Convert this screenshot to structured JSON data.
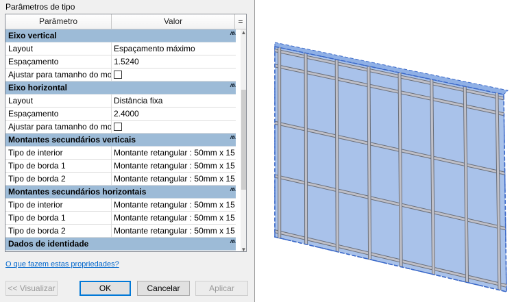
{
  "dialog": {
    "section_title": "Parâmetros de tipo",
    "columns": [
      "Parâmetro",
      "Valor",
      "="
    ],
    "groups": [
      {
        "title": "Eixo vertical",
        "rows": [
          {
            "param": "Layout",
            "value": "Espaçamento máximo"
          },
          {
            "param": "Espaçamento",
            "value": "1.5240"
          },
          {
            "param": "Ajustar para tamanho do mon",
            "value": "",
            "checkbox": true
          }
        ]
      },
      {
        "title": "Eixo horizontal",
        "rows": [
          {
            "param": "Layout",
            "value": "Distância fixa"
          },
          {
            "param": "Espaçamento",
            "value": "2.4000"
          },
          {
            "param": "Ajustar para tamanho do mon",
            "value": "",
            "checkbox": true
          }
        ]
      },
      {
        "title": "Montantes secundários verticais",
        "rows": [
          {
            "param": "Tipo de interior",
            "value": "Montante retangular : 50mm x 15"
          },
          {
            "param": "Tipo de borda 1",
            "value": "Montante retangular : 50mm x 15"
          },
          {
            "param": "Tipo de borda 2",
            "value": "Montante retangular : 50mm x 15"
          }
        ]
      },
      {
        "title": "Montantes secundários horizontais",
        "rows": [
          {
            "param": "Tipo de interior",
            "value": "Montante retangular : 50mm x 15"
          },
          {
            "param": "Tipo de borda 1",
            "value": "Montante retangular : 50mm x 15"
          },
          {
            "param": "Tipo de borda 2",
            "value": "Montante retangular : 50mm x 15"
          }
        ]
      },
      {
        "title": "Dados de identidade",
        "rows": []
      }
    ],
    "help_link": "O que fazem estas propriedades?",
    "buttons": {
      "preview": "<< Visualizar",
      "ok": "OK",
      "cancel": "Cancelar",
      "apply": "Aplicar"
    }
  },
  "colors": {
    "group_header": "#9dbbd7",
    "glass": "#a9c2ea",
    "mullion": "#c0c0c8",
    "selection_outline": "#3a68c8"
  },
  "icons": {
    "collapse": "double-chevron-up-icon",
    "scroll_up": "scroll-up-arrow-icon",
    "scroll_down": "scroll-down-arrow-icon"
  }
}
